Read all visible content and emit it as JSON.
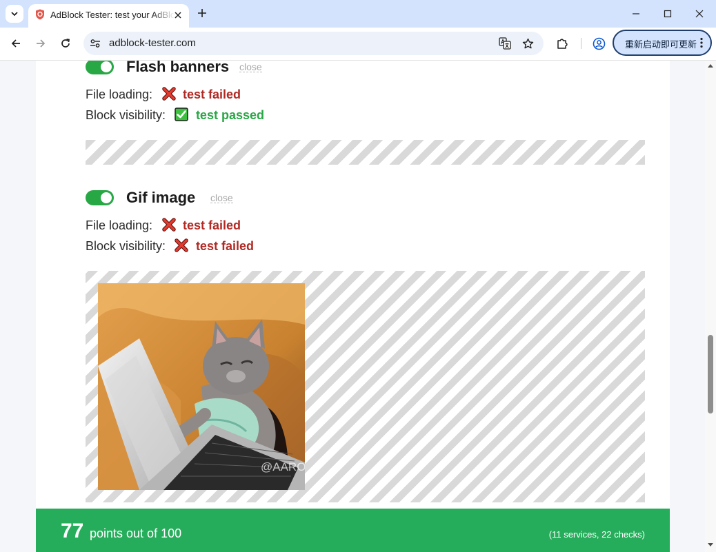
{
  "browser": {
    "tab": {
      "title": "AdBlock Tester: test your AdBlock"
    },
    "address_bar": {
      "url": "adblock-tester.com"
    },
    "update_button": {
      "label": "重新启动即可更新"
    }
  },
  "sections": [
    {
      "title": "Flash banners",
      "close_label": "close",
      "toggle_on": true,
      "results": [
        {
          "label": "File loading:",
          "status": "test failed",
          "icon": "red-cross-icon"
        },
        {
          "label": "Block visibility:",
          "status": "test passed",
          "icon": "green-check-icon"
        }
      ]
    },
    {
      "title": "Gif image",
      "close_label": "close",
      "toggle_on": true,
      "results": [
        {
          "label": "File loading:",
          "status": "test failed",
          "icon": "red-cross-icon"
        },
        {
          "label": "Block visibility:",
          "status": "test failed",
          "icon": "red-cross-icon"
        }
      ],
      "image_watermark": "@AARON"
    }
  ],
  "score": {
    "points": "77",
    "text": "points out of 100",
    "detail": "(11 services, 22 checks)"
  },
  "colors": {
    "toggle": "#28a745",
    "failed": "#b12a24",
    "passed": "#28a745",
    "score_bar": "#26ad5b",
    "tab_strip": "#d3e3fd"
  }
}
